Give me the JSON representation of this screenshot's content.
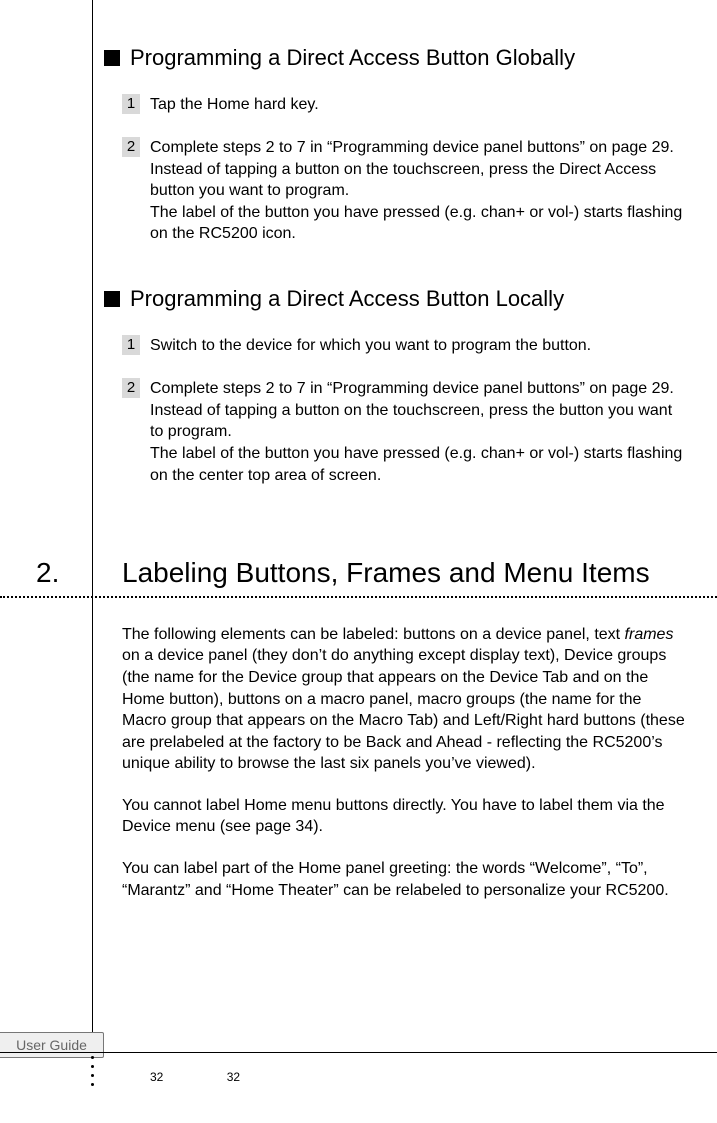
{
  "section_global": {
    "title": "Programming a Direct Access Button Globally",
    "steps": [
      {
        "num": "1",
        "text": "Tap the Home hard key."
      },
      {
        "num": "2",
        "text": "Complete steps 2 to 7 in “Programming device panel buttons” on page 29. Instead of tapping a button on the touchscreen, press the Direct Access button you want to program.\nThe label of the button you have pressed (e.g. chan+ or vol-) starts flashing on the RC5200 icon."
      }
    ]
  },
  "section_local": {
    "title": "Programming a Direct Access Button Locally",
    "steps": [
      {
        "num": "1",
        "text": "Switch to the device for which you want to program the button."
      },
      {
        "num": "2",
        "text": "Complete steps 2 to 7 in “Programming device panel buttons” on page 29. Instead of tapping a button on the touchscreen, press the button you want to program.\nThe label of the button you have pressed (e.g. chan+ or vol-) starts flashing on the center top area of screen."
      }
    ]
  },
  "main_section": {
    "num": "2.",
    "title": "Labeling Buttons, Frames and Menu Items",
    "p1_a": "The following elements can be labeled: buttons on a device panel, text ",
    "p1_italic": "frames",
    "p1_b": " on a device panel (they don’t do anything except display text), Device groups (the name for the Device group that appears on the Device Tab and on the Home button), buttons on a macro panel, macro groups (the name for the Macro group that appears on the Macro Tab) and Left/Right hard buttons (these are prelabeled at the factory to be Back and Ahead - reflecting the RC5200’s unique ability to browse the last six panels you’ve viewed).",
    "p2": "You cannot label Home menu buttons directly. You have to label them via the Device menu (see page 34).",
    "p3": "You can label part of the Home panel greeting: the words “Welcome”, “To”, “Marantz” and “Home Theater” can be relabeled to personalize your RC5200."
  },
  "footer": {
    "tab": "User Guide",
    "page_a": "32",
    "page_b": "32"
  }
}
